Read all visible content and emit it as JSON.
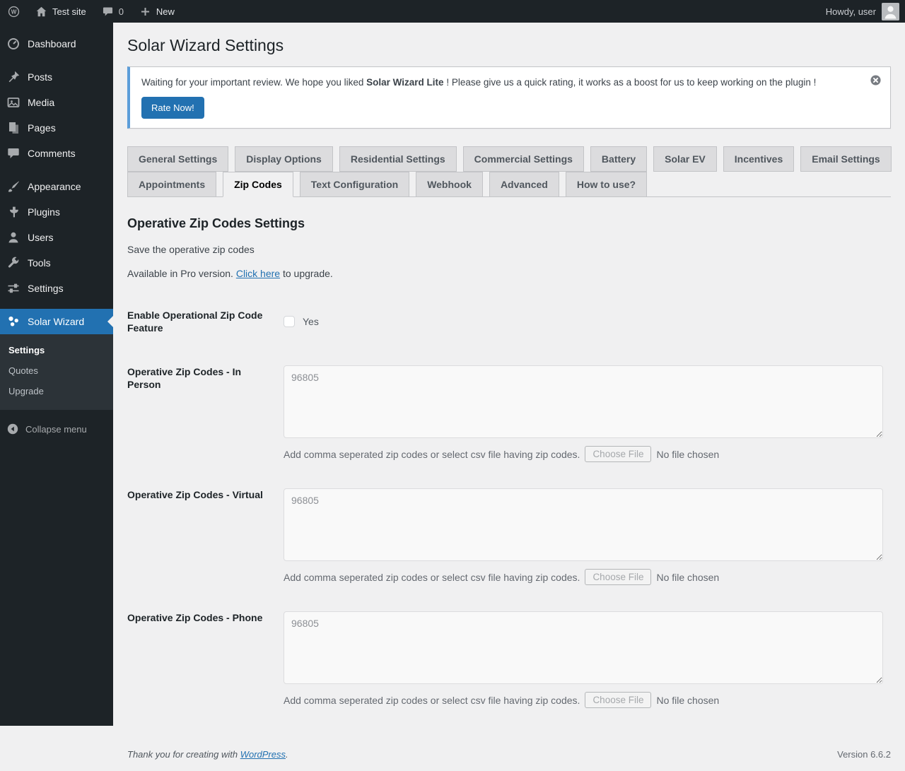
{
  "admin_bar": {
    "site_name": "Test site",
    "comments_count": "0",
    "new_label": "New",
    "howdy": "Howdy, user"
  },
  "sidebar": {
    "items": [
      {
        "label": "Dashboard",
        "icon": "dashboard-icon",
        "sep_before": false
      },
      {
        "label": "Posts",
        "icon": "pin-icon",
        "sep_before": true
      },
      {
        "label": "Media",
        "icon": "media-icon",
        "sep_before": false
      },
      {
        "label": "Pages",
        "icon": "pages-icon",
        "sep_before": false
      },
      {
        "label": "Comments",
        "icon": "comment-icon",
        "sep_before": false
      },
      {
        "label": "Appearance",
        "icon": "brush-icon",
        "sep_before": true
      },
      {
        "label": "Plugins",
        "icon": "plugin-icon",
        "sep_before": false
      },
      {
        "label": "Users",
        "icon": "user-icon",
        "sep_before": false
      },
      {
        "label": "Tools",
        "icon": "wrench-icon",
        "sep_before": false
      },
      {
        "label": "Settings",
        "icon": "sliders-icon",
        "sep_before": false
      }
    ],
    "solar_wizard": {
      "label": "Solar Wizard",
      "submenu": [
        {
          "label": "Settings",
          "current": true
        },
        {
          "label": "Quotes",
          "current": false
        },
        {
          "label": "Upgrade",
          "current": false
        }
      ]
    },
    "collapse_label": "Collapse menu"
  },
  "page": {
    "title": "Solar Wizard Settings",
    "notice": {
      "text_before": "Waiting for your important review. We hope you liked ",
      "text_bold": "Solar Wizard Lite",
      "text_after": " ! Please give us a quick rating, it works as a boost for us to keep working on the plugin !",
      "button": "Rate Now!"
    },
    "tabs_row1": [
      "General Settings",
      "Display Options",
      "Residential Settings",
      "Commercial Settings",
      "Battery",
      "Solar EV",
      "Incentives",
      "Email Settings"
    ],
    "tabs_row2": [
      "Appointments",
      "Zip Codes",
      "Text Configuration",
      "Webhook",
      "Advanced",
      "How to use?"
    ],
    "active_tab": "Zip Codes",
    "section": {
      "heading": "Operative Zip Codes Settings",
      "subtitle": "Save the operative zip codes",
      "pro_before": "Available in Pro version. ",
      "pro_link": "Click here",
      "pro_after": " to upgrade."
    },
    "form": {
      "enable_label": "Enable Operational Zip Code Feature",
      "enable_checkbox_label": "Yes",
      "enable_checked": false,
      "rows": [
        {
          "label": "Operative Zip Codes - In Person",
          "value": "96805",
          "description": "Add comma seperated zip codes or select csv file having zip codes.",
          "file_button": "Choose File",
          "file_status": "No file chosen"
        },
        {
          "label": "Operative Zip Codes - Virtual",
          "value": "96805",
          "description": "Add comma seperated zip codes or select csv file having zip codes.",
          "file_button": "Choose File",
          "file_status": "No file chosen"
        },
        {
          "label": "Operative Zip Codes - Phone",
          "value": "96805",
          "description": "Add comma seperated zip codes or select csv file having zip codes.",
          "file_button": "Choose File",
          "file_status": "No file chosen"
        }
      ]
    },
    "footer": {
      "thanks_before": "Thank you for creating with ",
      "thanks_link": "WordPress",
      "thanks_after": ".",
      "version": "Version 6.6.2"
    }
  },
  "colors": {
    "accent": "#2271b1",
    "notice_border": "#5b9dd9",
    "admin_dark": "#1d2327",
    "page_bg": "#f0f0f1"
  }
}
